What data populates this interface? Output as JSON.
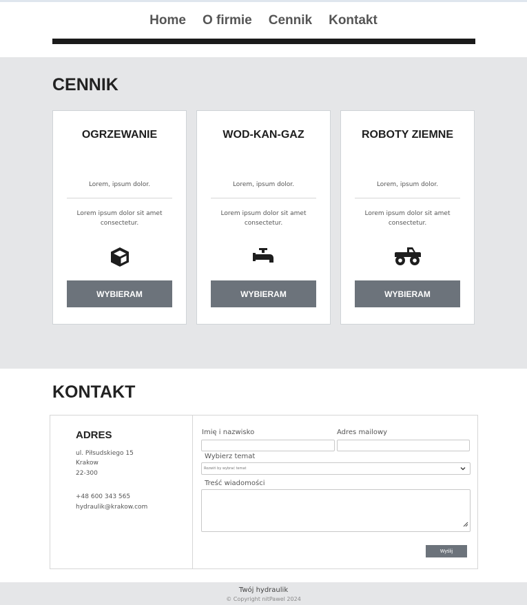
{
  "nav": {
    "links": [
      "Home",
      "O firmie",
      "Cennik",
      "Kontakt"
    ]
  },
  "pricing": {
    "title": "CENNIK",
    "cards": [
      {
        "title": "OGRZEWANIE",
        "subtitle": "Lorem, ipsum dolor.",
        "description": "Lorem ipsum dolor sit amet consectetur.",
        "icon": "cube-icon",
        "button": "WYBIERAM"
      },
      {
        "title": "WOD-KAN-GAZ",
        "subtitle": "Lorem, ipsum dolor.",
        "description": "Lorem ipsum dolor sit amet consectetur.",
        "icon": "faucet-icon",
        "button": "WYBIERAM"
      },
      {
        "title": "ROBOTY ZIEMNE",
        "subtitle": "Lorem, ipsum dolor.",
        "description": "Lorem ipsum dolor sit amet consectetur.",
        "icon": "truck-monster-icon",
        "button": "WYBIERAM"
      }
    ]
  },
  "contact": {
    "title": "KONTAKT",
    "address": {
      "title": "ADRES",
      "street": "ul. Piłsudskiego 15",
      "city": "Krakow",
      "postal": "22-300",
      "phone": "+48 600 343 565",
      "email": "hydraulik@krakow.com"
    },
    "form": {
      "name_label": "Imię i nazwisko",
      "email_label": "Adres mailowy",
      "topic_label": "Wybierz temat",
      "topic_selected": "Rozwiń by wybrać temat",
      "message_label": "Treść wiadomości",
      "send_label": "Wyślij"
    }
  },
  "footer": {
    "line1": "Twój hydraulik",
    "line2": "© Copyright nitPawel 2024"
  },
  "colors": {
    "accent_button": "#6c737b",
    "section_bg": "#e5e6e8",
    "nav_bar": "#1a1a1a"
  }
}
